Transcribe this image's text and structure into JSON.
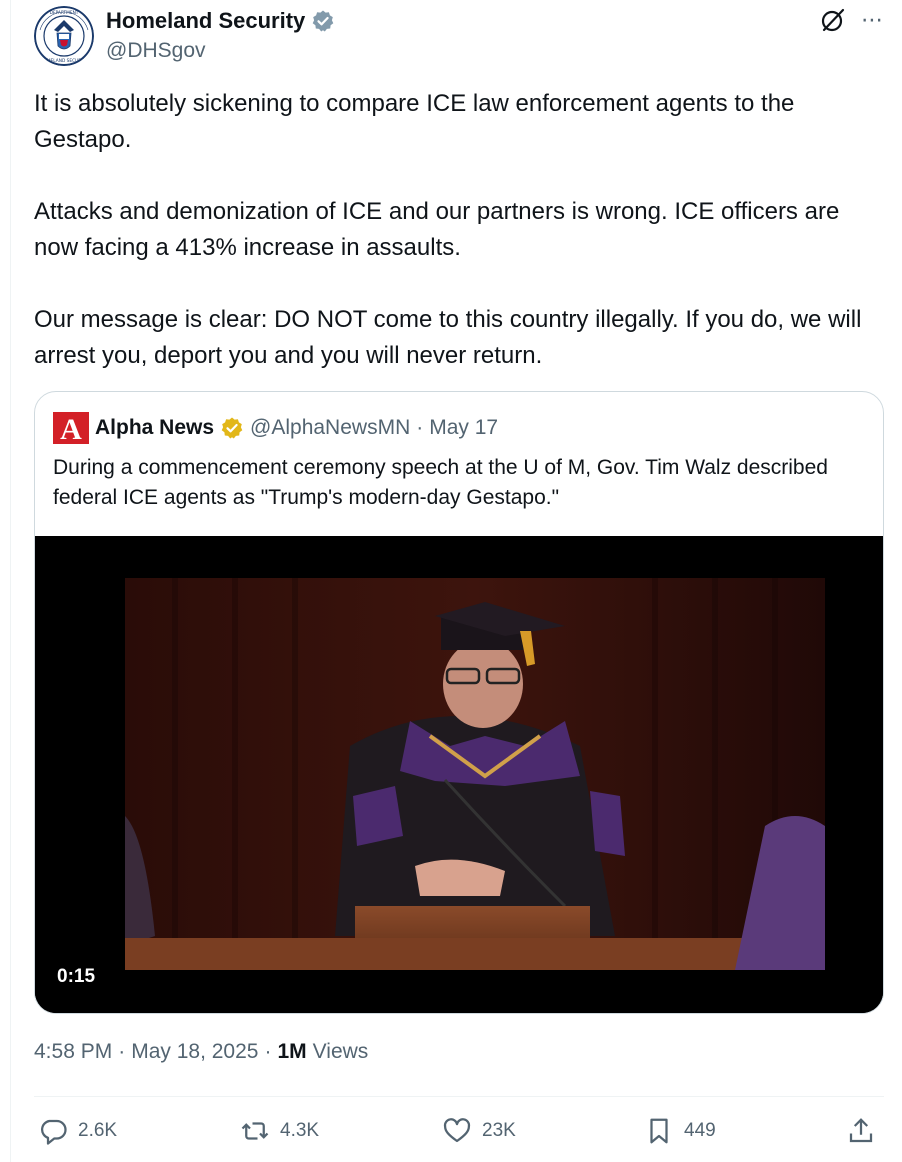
{
  "tweet": {
    "author": {
      "name": "Homeland Security",
      "handle": "@DHSgov",
      "seal_text": "U.S. DEPARTMENT OF HOMELAND SECURITY"
    },
    "paragraphs": [
      "It is absolutely sickening to compare ICE law enforcement agents to the Gestapo.",
      "Attacks and demonization of ICE and our partners is wrong. ICE officers are now facing a 413% increase in assaults.",
      "Our message is clear: DO NOT come to this country illegally. If you do, we will arrest you, deport you and you will never return."
    ],
    "quote": {
      "logo_letter": "A",
      "name": "Alpha News",
      "handle": "@AlphaNewsMN",
      "separator": "·",
      "date": "May 17",
      "text": "During a commencement ceremony speech at the U of M, Gov. Tim Walz described federal ICE agents as \"Trump's modern-day Gestapo.\"",
      "video_duration": "0:15"
    },
    "time": "4:58 PM",
    "sep": "·",
    "date": "May 18, 2025",
    "views_count": "1M",
    "views_label": "Views",
    "actions": {
      "replies": "2.6K",
      "reposts": "4.3K",
      "likes": "23K",
      "bookmarks": "449"
    }
  },
  "colors": {
    "text": "#0f1419",
    "secondary": "#536471",
    "verified_gold": "#e2b719",
    "verified_blue": "#829aab",
    "border": "#cfd9de",
    "alpha_red": "#d32027"
  }
}
